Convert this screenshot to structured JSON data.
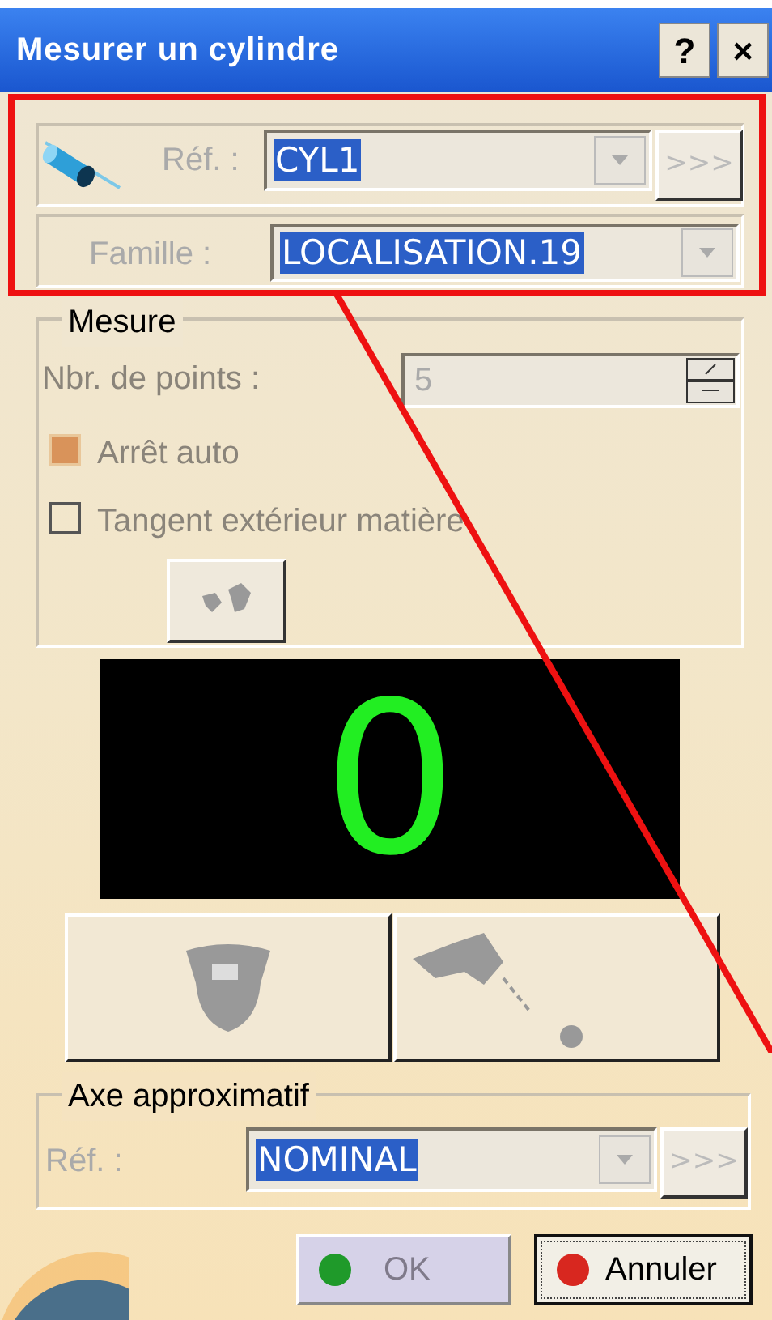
{
  "window": {
    "title": "Mesurer un cylindre",
    "buttons": [
      "?",
      "×"
    ]
  },
  "reference": {
    "label": "Réf. :",
    "value": "CYL1",
    "more": ">>>"
  },
  "family": {
    "label": "Famille :",
    "value": "LOCALISATION.19"
  },
  "measure": {
    "title": "Mesure",
    "points_label": "Nbr. de points :",
    "points_value": "5",
    "checkboxes": [
      {
        "label": "Arrêt auto",
        "checked": true
      },
      {
        "label": "Tangent extérieur matière",
        "checked": false
      }
    ]
  },
  "display": {
    "value": "0"
  },
  "axis": {
    "title": "Axe approximatif",
    "label": "Réf. :",
    "value": "NOMINAL",
    "more": ">>>"
  },
  "buttons": [
    {
      "label": "OK",
      "disabled": true,
      "color": "#1f9a2a"
    },
    {
      "label": "Annuler",
      "disabled": false,
      "color": "#d8271f"
    }
  ]
}
